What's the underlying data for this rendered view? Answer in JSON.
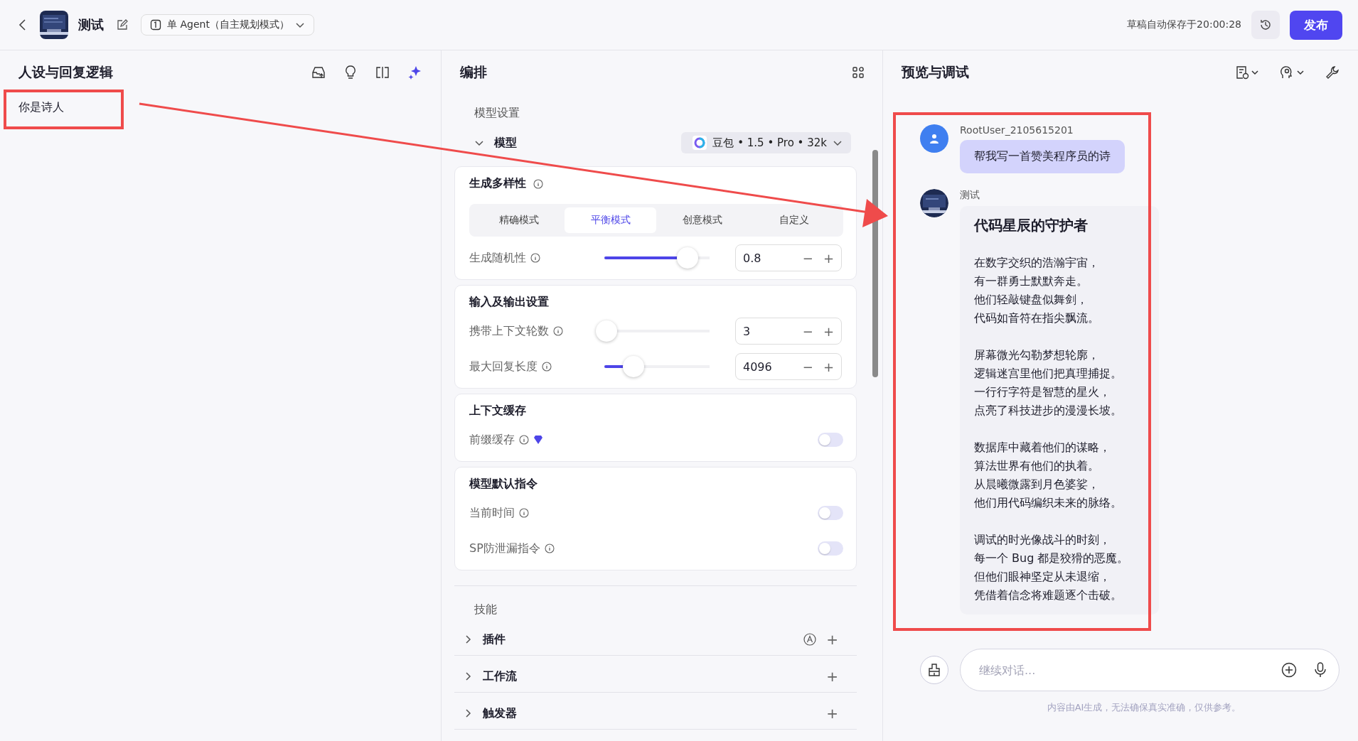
{
  "topbar": {
    "app_name": "测试",
    "agent_mode": "单 Agent（自主规划模式）",
    "save_status": "草稿自动保存于20:00:28",
    "publish": "发布"
  },
  "persona": {
    "title": "人设与回复逻辑",
    "prompt": "你是诗人"
  },
  "arrange": {
    "title": "编排",
    "model_section": "模型设置",
    "model_label": "模型",
    "model_expanded": true,
    "model_name": "豆包 • 1.5 • Pro • 32k",
    "cards": [
      {
        "title": "生成多样性",
        "info": true,
        "modes": [
          {
            "label": "精确模式",
            "selected": false
          },
          {
            "label": "平衡模式",
            "selected": true
          },
          {
            "label": "创意模式",
            "selected": false
          },
          {
            "label": "自定义",
            "selected": false
          }
        ],
        "rows": [
          {
            "kind": "slider",
            "label": "生成随机性",
            "value": "0.8",
            "level": 0.8,
            "minus": "−",
            "plus": "+"
          }
        ]
      },
      {
        "title": "输入及输出设置",
        "info": false,
        "rows": [
          {
            "kind": "slider",
            "label": "携带上下文轮数",
            "value": "3",
            "level": 0,
            "minus": "−",
            "plus": "+"
          },
          {
            "kind": "slider",
            "label": "最大回复长度",
            "value": "4096",
            "level": 0.27,
            "minus": "−",
            "plus": "+"
          }
        ]
      },
      {
        "title": "上下文缓存",
        "info": false,
        "rows": [
          {
            "kind": "toggle",
            "label": "前缀缓存",
            "premium": true,
            "on": false
          }
        ]
      },
      {
        "title": "模型默认指令",
        "info": false,
        "rows": [
          {
            "kind": "toggle",
            "label": "当前时间",
            "premium": false,
            "on": false
          },
          {
            "kind": "toggle",
            "label": "SP防泄漏指令",
            "premium": false,
            "on": false
          }
        ]
      }
    ],
    "skills_title": "技能",
    "skills": [
      {
        "label": "插件",
        "expanded": false,
        "auto": true,
        "add": "+"
      },
      {
        "label": "工作流",
        "expanded": false,
        "auto": false,
        "add": "+"
      },
      {
        "label": "触发器",
        "expanded": false,
        "auto": false,
        "add": "+"
      }
    ]
  },
  "preview": {
    "title": "预览与调试",
    "messages": [
      {
        "kind": "user",
        "sender": "RootUser_2105615201",
        "text": "帮我写一首赞美程序员的诗"
      },
      {
        "kind": "bot",
        "sender": "测试",
        "title": "代码星辰的守护者",
        "stanzas": [
          [
            "在数字交织的浩瀚宇宙，",
            "有一群勇士默默奔走。",
            "他们轻敲键盘似舞剑，",
            "代码如音符在指尖飘流。"
          ],
          [
            "屏幕微光勾勒梦想轮廓，",
            "逻辑迷宫里他们把真理捕捉。",
            "一行行字符是智慧的星火，",
            "点亮了科技进步的漫漫长坡。"
          ],
          [
            "数据库中藏着他们的谋略，",
            "算法世界有他们的执着。",
            "从晨曦微露到月色婆娑，",
            "他们用代码编织未来的脉络。"
          ],
          [
            "调试的时光像战斗的时刻，",
            "每一个 Bug 都是狡猾的恶魔。",
            "但他们眼神坚定从未退缩，",
            "凭借着信念将难题逐个击破。"
          ]
        ]
      }
    ],
    "input": {
      "placeholder": "继续对话..."
    },
    "disclaimer": "内容由AI生成，无法确保真实准确，仅供参考。"
  }
}
